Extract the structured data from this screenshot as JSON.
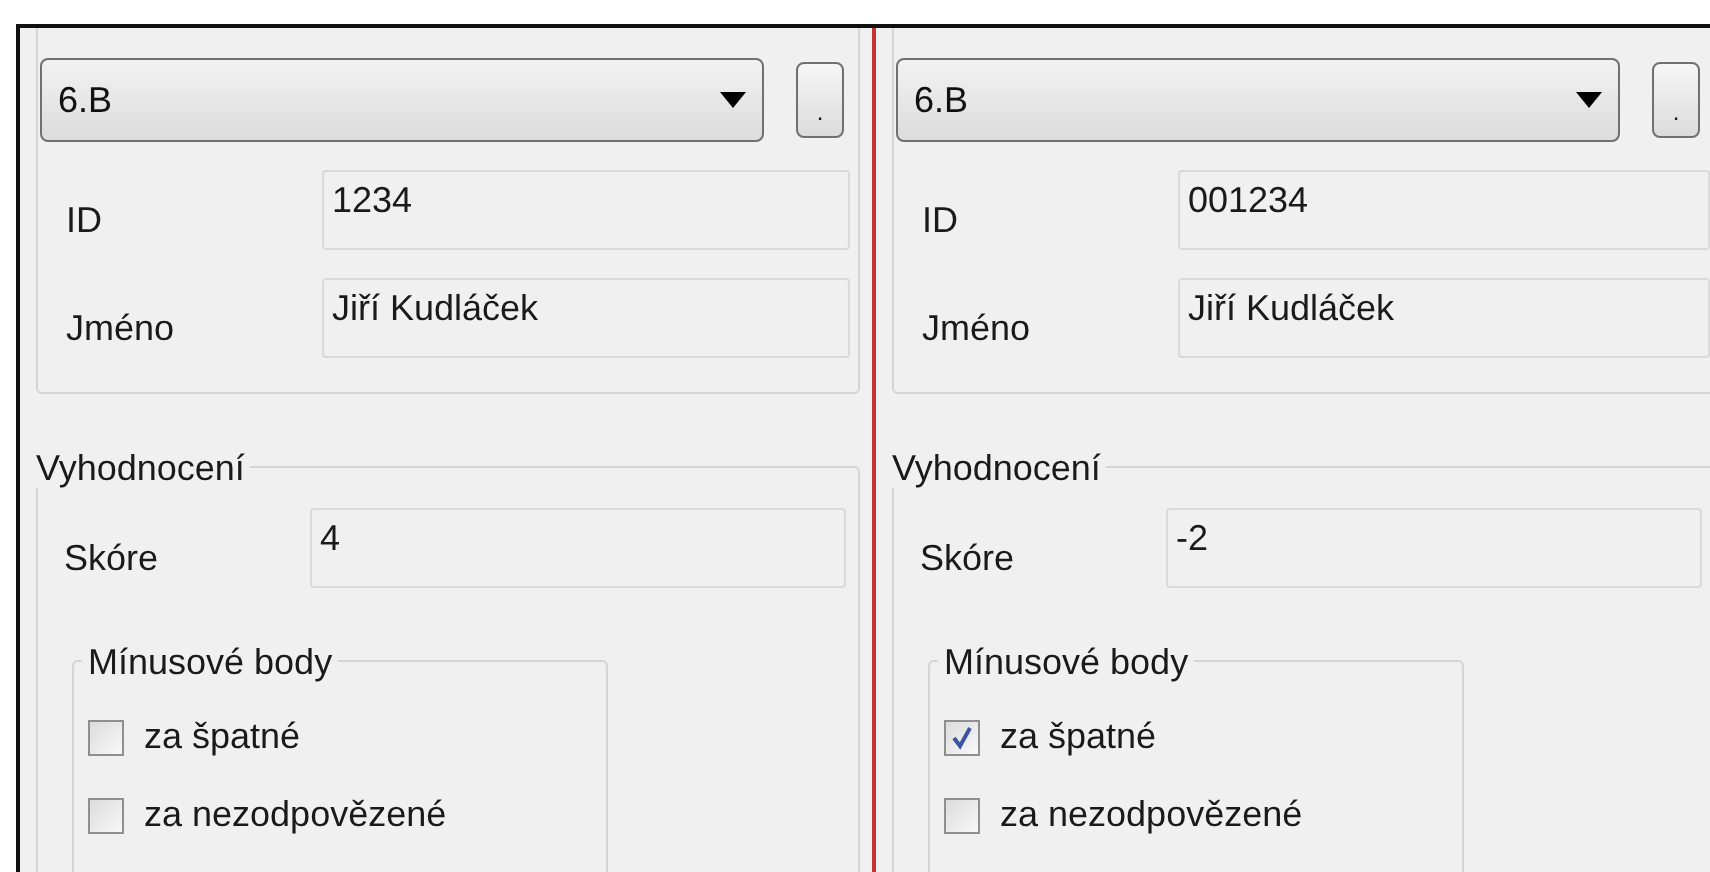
{
  "panels": [
    {
      "class_select": {
        "value": "6.B"
      },
      "browse_button": ".",
      "fields": [
        {
          "label": "ID",
          "value": "1234"
        },
        {
          "label": "Jméno",
          "value": "Jiří Kudláček"
        }
      ],
      "evaluation": {
        "title": "Vyhodnocení",
        "score_label": "Skóre",
        "score": "4",
        "penalty": {
          "title": "Mínusové body",
          "options": [
            {
              "label": "za špatné",
              "checked": false
            },
            {
              "label": "za nezodpovězené",
              "checked": false
            }
          ]
        }
      }
    },
    {
      "class_select": {
        "value": "6.B"
      },
      "browse_button": ".",
      "fields": [
        {
          "label": "ID",
          "value": "001234"
        },
        {
          "label": "Jméno",
          "value": "Jiří Kudláček"
        }
      ],
      "evaluation": {
        "title": "Vyhodnocení",
        "score_label": "Skóre",
        "score": "-2",
        "penalty": {
          "title": "Mínusové body",
          "options": [
            {
              "label": "za špatné",
              "checked": true
            },
            {
              "label": "za nezodpovězené",
              "checked": false
            }
          ]
        }
      }
    }
  ]
}
